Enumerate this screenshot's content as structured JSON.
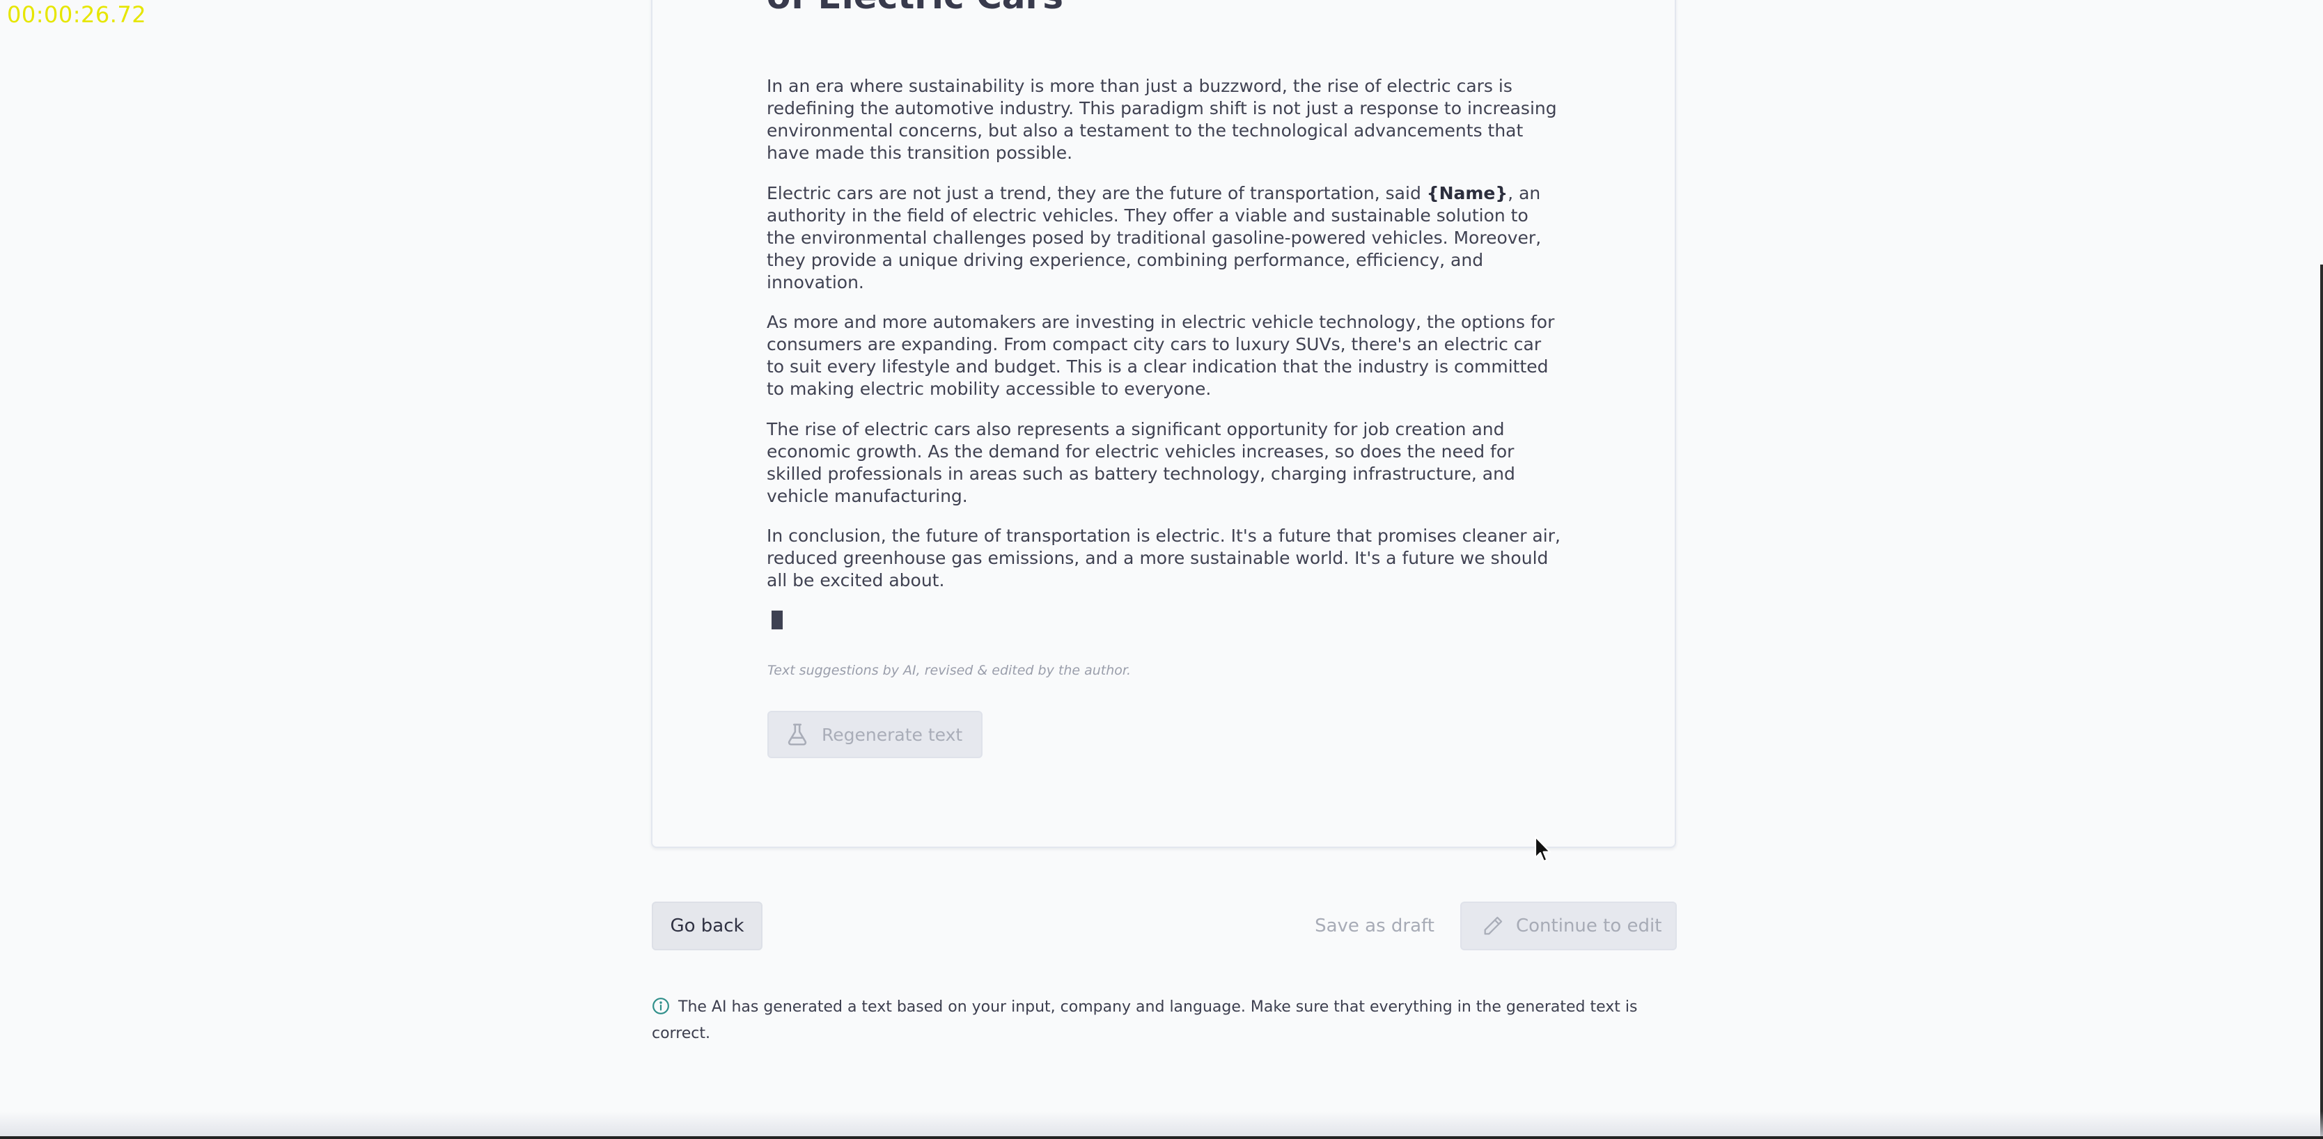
{
  "timer": "00:00:26.72",
  "article": {
    "title_line": "of Electric Cars\"",
    "paragraphs": [
      "In an era where sustainability is more than just a buzzword, the rise of electric cars is redefining the automotive industry. This paradigm shift is not just a response to increasing environmental concerns, but also a testament to the technological advancements that have made this transition possible.",
      {
        "before": "Electric cars are not just a trend, they are the future of transportation, said ",
        "placeholder": "{Name}",
        "after": ", an authority in the field of electric vehicles. They offer a viable and sustainable solution to the environmental challenges posed by traditional gasoline-powered vehicles. Moreover, they provide a unique driving experience, combining performance, efficiency, and innovation."
      },
      "As more and more automakers are investing in electric vehicle technology, the options for consumers are expanding. From compact city cars to luxury SUVs, there's an electric car to suit every lifestyle and budget. This is a clear indication that the industry is committed to making electric mobility accessible to everyone.",
      "The rise of electric cars also represents a significant opportunity for job creation and economic growth. As the demand for electric vehicles increases, so does the need for skilled professionals in areas such as battery technology, charging infrastructure, and vehicle manufacturing.",
      "In conclusion, the future of transportation is electric. It's a future that promises cleaner air, reduced greenhouse gas emissions, and a more sustainable world. It's a future we should all be excited about."
    ],
    "ai_note": "Text suggestions by AI, revised & edited by the author."
  },
  "buttons": {
    "regenerate": "Regenerate text",
    "go_back": "Go back",
    "save_draft": "Save as draft",
    "continue_edit": "Continue to edit"
  },
  "info": {
    "text": "The AI has generated a text based on your input, company and language. Make sure that everything in the generated text is correct."
  },
  "icons": {
    "regenerate": "flask-icon",
    "continue": "pencil-icon",
    "info": "info-circle-icon",
    "cursor": "mouse-pointer-icon"
  },
  "colors": {
    "background": "#f9fafb",
    "text": "#404252",
    "timer": "#e6e600",
    "disabled": "#a7abb6",
    "info_accent": "#2f8f8a"
  }
}
